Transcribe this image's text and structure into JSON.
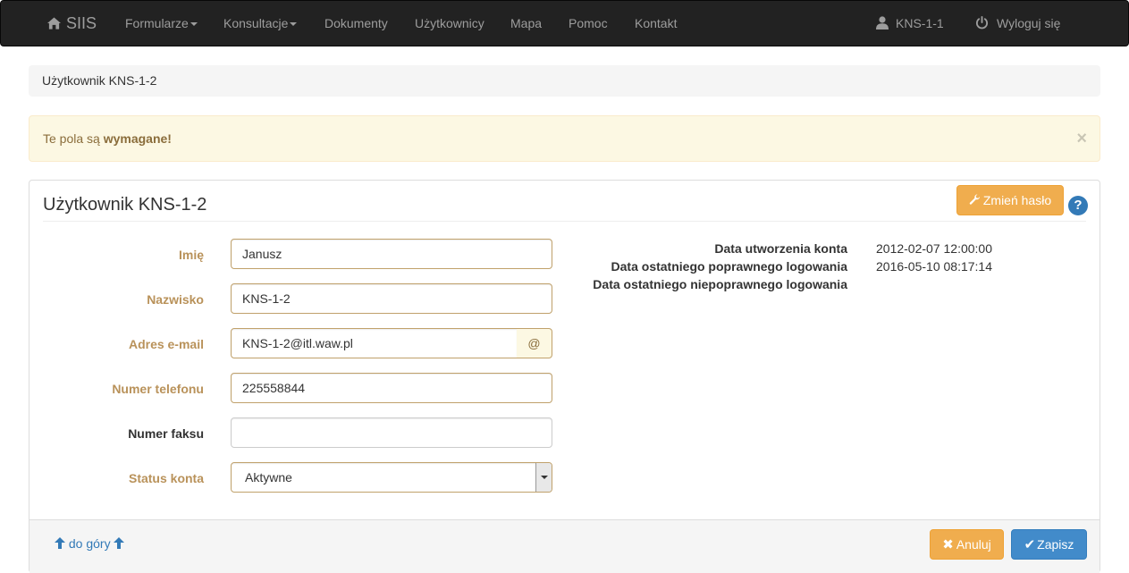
{
  "navbar": {
    "brand": "SIIS",
    "items": [
      {
        "label": "Formularze"
      },
      {
        "label": "Konsultacje"
      },
      {
        "label": "Dokumenty"
      },
      {
        "label": "Użytkownicy"
      },
      {
        "label": "Mapa"
      },
      {
        "label": "Pomoc"
      },
      {
        "label": "Kontakt"
      }
    ],
    "user": "KNS-1-1",
    "logout": "Wyloguj się",
    "colors": {
      "background": "#222222",
      "text": "#9d9d9d"
    }
  },
  "breadcrumb": {
    "current": "Użytkownik KNS-1-2"
  },
  "alert": {
    "prefix": "Te pola są ",
    "emphasis": "wymagane!",
    "close": "×"
  },
  "panel": {
    "title": "Użytkownik KNS-1-2",
    "change_password": "Zmień hasło",
    "help": "?",
    "fields": {
      "first_name": {
        "label": "Imię",
        "value": "Janusz"
      },
      "last_name": {
        "label": "Nazwisko",
        "value": "KNS-1-2"
      },
      "email": {
        "label": "Adres e-mail",
        "value": "KNS-1-2@itl.waw.pl",
        "addon": "@"
      },
      "phone": {
        "label": "Numer telefonu",
        "value": "225558844"
      },
      "fax": {
        "label": "Numer faksu",
        "value": ""
      },
      "status": {
        "label": "Status konta",
        "value": "Aktywne"
      }
    },
    "info": {
      "created": {
        "label": "Data utworzenia konta",
        "value": "2012-02-07 12:00:00"
      },
      "last_ok_login": {
        "label": "Data ostatniego poprawnego logowania",
        "value": "2016-05-10 08:17:14"
      },
      "last_bad_login": {
        "label": "Data ostatniego niepoprawnego logowania",
        "value": ""
      }
    },
    "footer": {
      "to_top": "do góry",
      "cancel": "Anuluj",
      "save": "Zapisz"
    }
  },
  "colors": {
    "warning": "#f0ad4e",
    "primary": "#428bca",
    "alert_bg": "#fcf8e3",
    "required_label": "#b9925a"
  }
}
